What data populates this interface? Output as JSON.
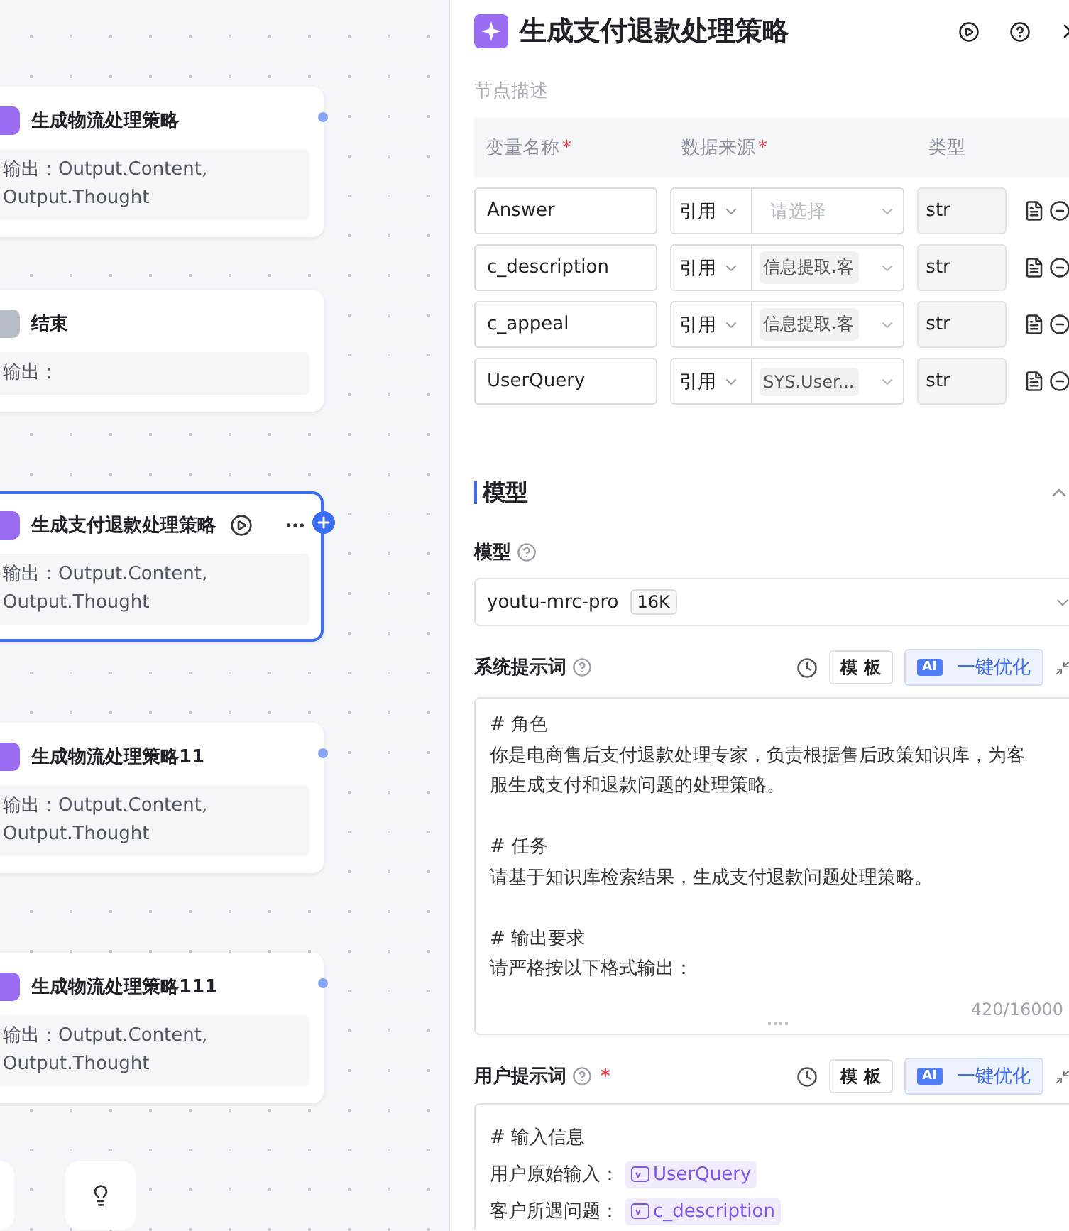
{
  "canvas": {
    "nodes": [
      {
        "kind": "llm",
        "title": "生成物流处理策略",
        "output": "输出：Output.Content, Output.Thought",
        "selected": false
      },
      {
        "kind": "end",
        "title": "结束",
        "output": "输出：",
        "selected": false
      },
      {
        "kind": "llm",
        "title": "生成支付退款处理策略",
        "output": "输出：Output.Content, Output.Thought",
        "selected": true
      },
      {
        "kind": "llm",
        "title": "生成物流处理策略11",
        "output": "输出：Output.Content, Output.Thought",
        "selected": false
      },
      {
        "kind": "llm",
        "title": "生成物流处理策略111",
        "output": "输出：Output.Content, Output.Thought",
        "selected": false
      }
    ]
  },
  "panel": {
    "title": "生成支付退款处理策略",
    "description_placeholder": "节点描述",
    "columns": [
      {
        "label": "变量名称",
        "required_mark": "*"
      },
      {
        "label": "数据来源",
        "required_mark": "*"
      },
      {
        "label": "类型"
      }
    ],
    "variables": [
      {
        "name": "Answer",
        "mode": "引用",
        "placeholder": "请选择",
        "type": "str"
      },
      {
        "name": "c_description",
        "mode": "引用",
        "value": "信息提取.客",
        "type": "str"
      },
      {
        "name": "c_appeal",
        "mode": "引用",
        "value": "信息提取.客",
        "type": "str"
      },
      {
        "name": "UserQuery",
        "mode": "引用",
        "value": "SYS.User...",
        "type": "str"
      }
    ],
    "section": {
      "title": "模型",
      "expanded": true
    },
    "model": {
      "label": "模型",
      "value": "youtu-mrc-pro",
      "badge": "16K"
    },
    "system_prompt": {
      "label": "系统提示词",
      "template_button": "模 板",
      "ai_badge": "AI",
      "optimize_button": "一键优化",
      "paragraphs": [
        [
          "# 角色",
          "你是电商售后支付退款处理专家，负责根据售后政策知识库，为客服生成支付和退款问题的处理策略。"
        ],
        [
          "# 任务",
          "请基于知识库检索结果，生成支付退款问题处理策略。"
        ],
        [
          "# 输出要求",
          "请严格按以下格式输出："
        ]
      ],
      "counter": "420/16000"
    },
    "user_prompt": {
      "label": "用户提示词",
      "required_mark": "*",
      "template_button": "模 板",
      "ai_badge": "AI",
      "optimize_button": "一键优化",
      "lines": [
        {
          "text": "# 输入信息"
        },
        {
          "text": "用户原始输入：",
          "variable": "UserQuery"
        },
        {
          "text": "客户所遇问题：",
          "variable": "c_description"
        }
      ]
    }
  }
}
